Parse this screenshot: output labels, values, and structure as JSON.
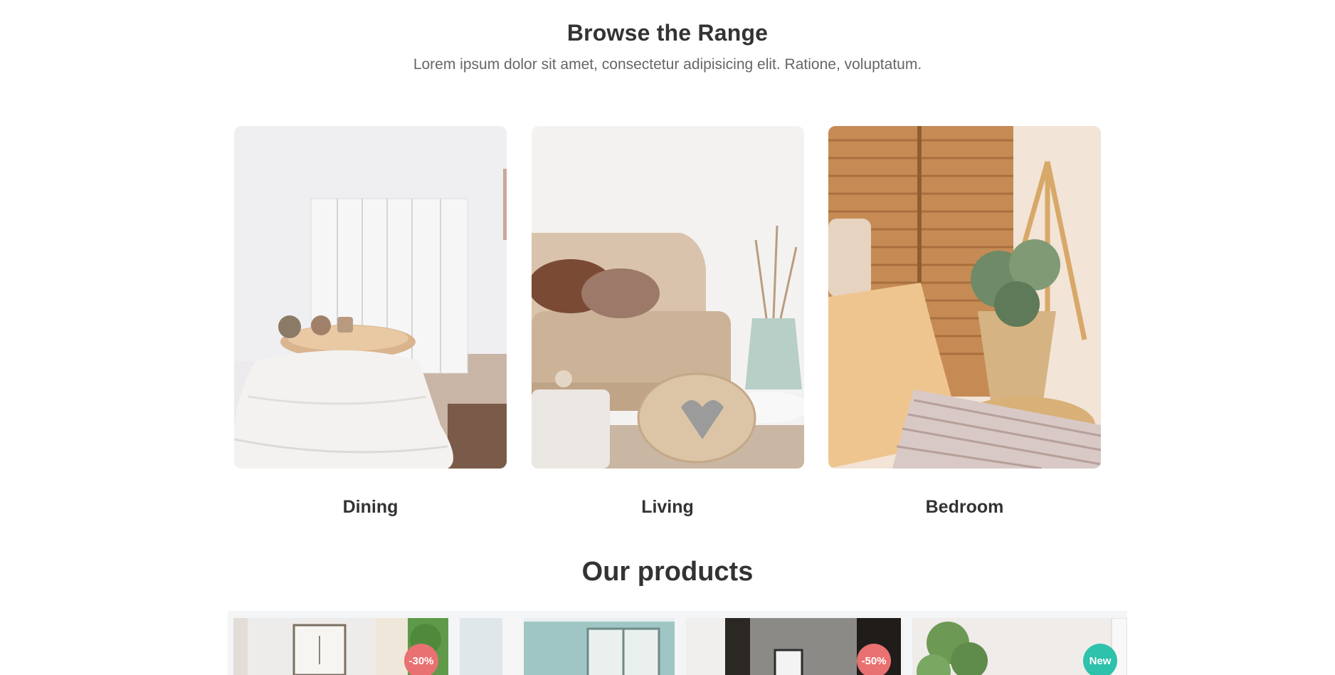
{
  "browse": {
    "title": "Browse the Range",
    "subtitle": "Lorem ipsum dolor sit amet, consectetur adipisicing elit. Ratione, voluptatum."
  },
  "ranges": [
    {
      "label": "Dining"
    },
    {
      "label": "Living"
    },
    {
      "label": "Bedroom"
    }
  ],
  "products": {
    "title": "Our products",
    "items": [
      {
        "badge": "-30%",
        "badge_color": "#e97171"
      },
      {
        "badge": "",
        "badge_color": ""
      },
      {
        "badge": "-50%",
        "badge_color": "#e97171"
      },
      {
        "badge": "New",
        "badge_color": "#2ec1ac"
      }
    ]
  },
  "colors": {
    "text_dark": "#333333",
    "text_muted": "#666666",
    "discount": "#e97171",
    "new": "#2ec1ac"
  }
}
